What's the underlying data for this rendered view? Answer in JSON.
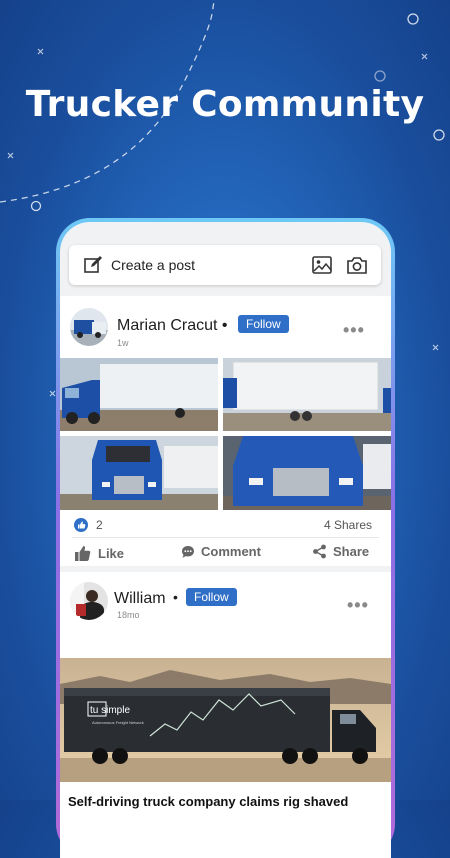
{
  "headline": "Trucker Community",
  "create_post": {
    "label": "Create a post",
    "image_icon": "image-icon",
    "camera_icon": "camera-icon",
    "edit_icon": "edit-icon"
  },
  "posts": [
    {
      "author": "Marian Cracut •",
      "follow_label": "Follow",
      "time": "1w",
      "likes": "2",
      "shares": "4 Shares",
      "actions": {
        "like": "Like",
        "comment": "Comment",
        "share": "Share"
      }
    },
    {
      "author": "William",
      "separator": "•",
      "follow_label": "Follow",
      "time": "18mo",
      "image_brand": "tu simple",
      "image_subtitle": "Autonomous Freight Network",
      "caption": "Self-driving truck company claims rig shaved"
    }
  ],
  "colors": {
    "accent": "#2f6fc7",
    "background": "#1f5cae",
    "like_icon": "#2f6fc7"
  }
}
